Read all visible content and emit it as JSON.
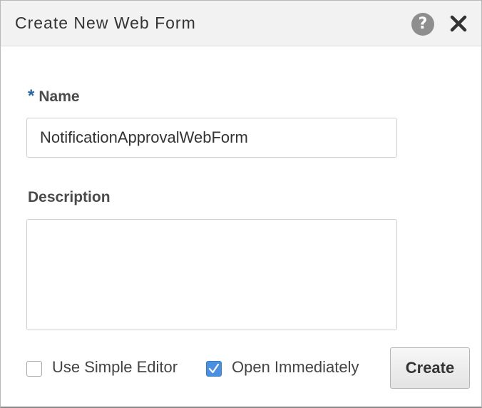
{
  "dialog": {
    "title": "Create New Web Form",
    "help_glyph": "?",
    "help_icon": "help-icon",
    "close_icon": "close-icon"
  },
  "form": {
    "name_required_marker": "*",
    "name_label": "Name",
    "name_value": "NotificationApprovalWebForm",
    "description_label": "Description",
    "description_value": ""
  },
  "options": {
    "simple_editor_label": "Use Simple Editor",
    "simple_editor_checked": false,
    "open_immediately_label": "Open Immediately",
    "open_immediately_checked": true
  },
  "actions": {
    "create_label": "Create"
  },
  "colors": {
    "accent": "#4a90e2",
    "required_marker": "#2766a8",
    "titlebar_bg": "#f2f2f2"
  }
}
